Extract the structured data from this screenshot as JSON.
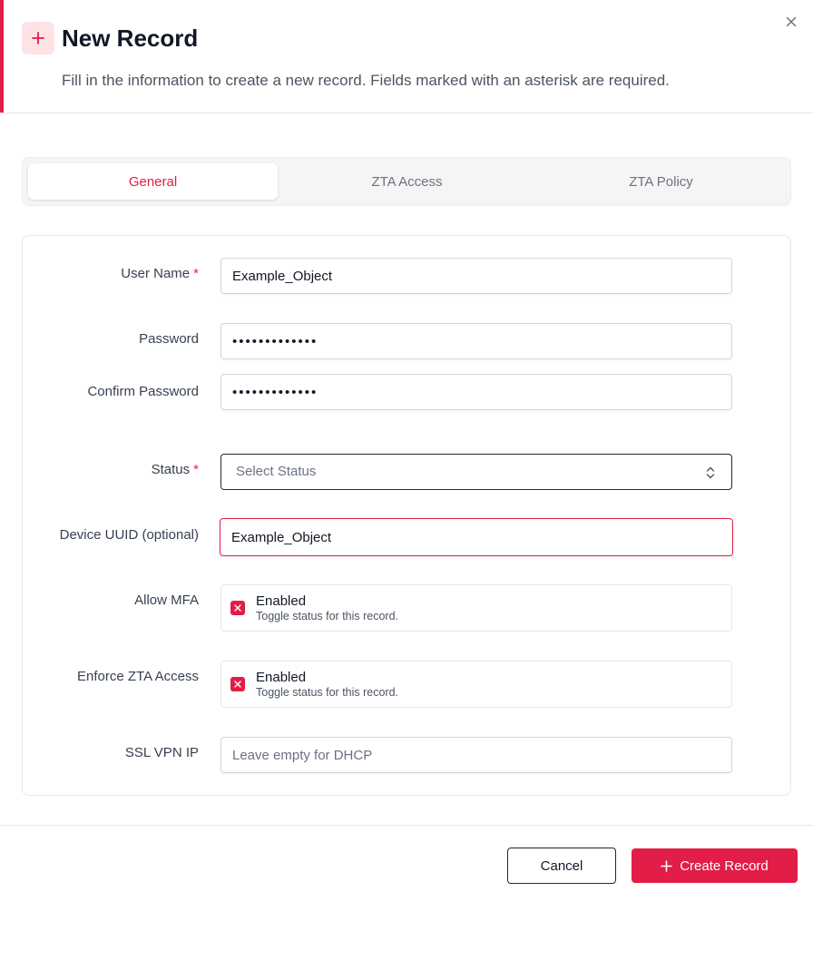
{
  "dialog": {
    "title": "New Record",
    "subtitle": "Fill in the information to create a new record. Fields marked with an asterisk are required.",
    "header_icon": "plus-icon",
    "close_icon": "close-icon",
    "accent_color": "#e11d48"
  },
  "tabs": [
    {
      "label": "General",
      "active": true
    },
    {
      "label": "ZTA Access",
      "active": false
    },
    {
      "label": "ZTA Policy",
      "active": false
    }
  ],
  "form": {
    "required_marker": "*",
    "user_name": {
      "label": "User Name",
      "value": "Example_Object"
    },
    "password": {
      "label": "Password",
      "value": "•••••••••••••"
    },
    "confirm_password": {
      "label": "Confirm Password",
      "value": "•••••••••••••"
    },
    "status": {
      "label": "Status",
      "placeholder": "Select Status",
      "icon": "chevron-up-down-icon"
    },
    "device_uuid": {
      "label": "Device UUID (optional)",
      "value": "Example_Object"
    },
    "allow_mfa": {
      "label": "Allow MFA",
      "title": "Enabled",
      "description": "Toggle status for this record."
    },
    "enforce_zta": {
      "label": "Enforce ZTA Access",
      "title": "Enabled",
      "description": "Toggle status for this record."
    },
    "ssl_vpn_ip": {
      "label": "SSL VPN IP",
      "placeholder": "Leave empty for DHCP"
    }
  },
  "footer": {
    "cancel_label": "Cancel",
    "create_label": "Create Record",
    "create_icon": "plus-icon"
  }
}
